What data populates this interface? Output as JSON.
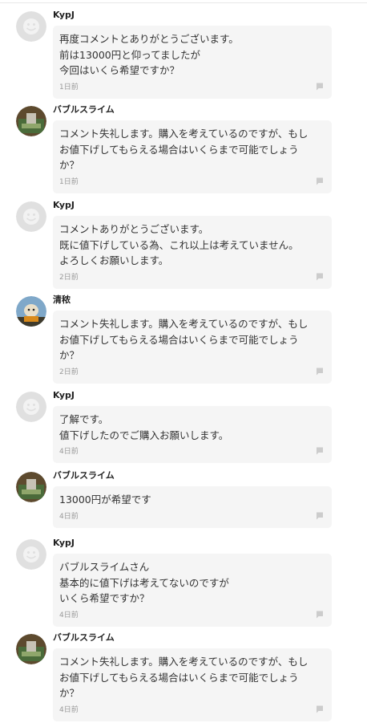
{
  "comments": [
    {
      "user": "KypJ",
      "avatar": "default-avatar-icon",
      "text": "再度コメントとありがとうございます。\n前は13000円と仰ってましたが\n今回はいくら希望ですか？",
      "time": "1日前"
    },
    {
      "user": "バブルスライム",
      "avatar": "photo-avatar",
      "text": "コメント失礼します。購入を考えているのですが、もし\nお値下げしてもらえる場合はいくらまで可能でしょう\nか？",
      "time": "1日前"
    },
    {
      "user": "KypJ",
      "avatar": "default-avatar-icon",
      "text": "コメントありがとうございます。\n既に値下げしている為、これ以上は考えていません。\nよろしくお願いします。",
      "time": "2日前"
    },
    {
      "user": "清秾",
      "avatar": "photo-avatar",
      "text": "コメント失礼します。購入を考えているのですが、もし\nお値下げしてもらえる場合はいくらまで可能でしょう\nか？",
      "time": "2日前"
    },
    {
      "user": "KypJ",
      "avatar": "default-avatar-icon",
      "text": "了解です。\n値下げしたのでご購入お願いします。",
      "time": "4日前"
    },
    {
      "user": "バブルスライム",
      "avatar": "photo-avatar",
      "text": "13000円が希望です",
      "time": "4日前"
    },
    {
      "user": "KypJ",
      "avatar": "default-avatar-icon",
      "text": "バブルスライムさん\n基本的に値下げは考えてないのですが\nいくら希望ですか？",
      "time": "4日前"
    },
    {
      "user": "バブルスライム",
      "avatar": "photo-avatar",
      "text": "コメント失礼します。購入を考えているのですが、もし\nお値下げしてもらえる場合はいくらまで可能でしょう\nか？",
      "time": "4日前"
    }
  ],
  "icons": {
    "report": "flag-icon"
  },
  "colors": {
    "bubble": "#f5f5f5",
    "time": "#999999",
    "username": "#222222"
  }
}
